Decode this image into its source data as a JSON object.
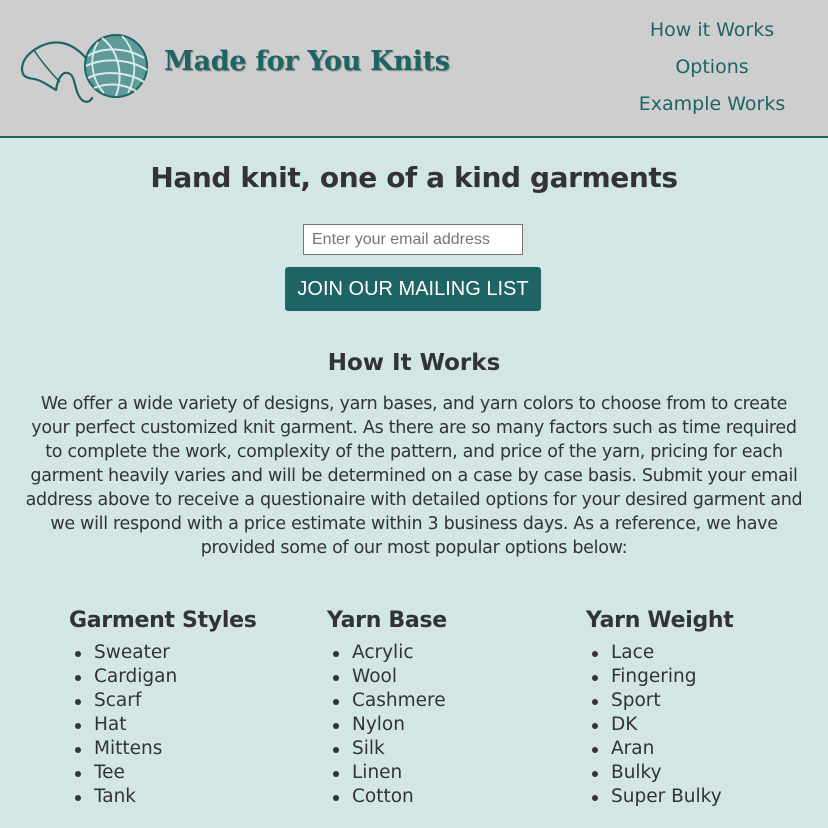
{
  "header": {
    "logo_icon": "yarn-ball-icon",
    "brand": "Made for You Knits",
    "nav": [
      "How it Works",
      "Options",
      "Example Works"
    ]
  },
  "hero": {
    "title": "Hand knit, one of a kind garments",
    "email_placeholder": "Enter your email address",
    "join_label": "JOIN OUR MAILING LIST"
  },
  "how_it_works": {
    "title": "How It Works",
    "body": "We offer a wide variety of designs, yarn bases, and yarn colors to choose from to create your perfect customized knit garment. As there are so many factors such as time required to complete the work, complexity of the pattern, and price of the yarn, pricing for each garment heavily varies and will be determined on a case by case basis. Submit your email address above to receive a questionaire with detailed options for your desired garment and we will respond with a price estimate within 3 business days. As a reference, we have provided some of our most popular options below:"
  },
  "options": [
    {
      "title": "Garment Styles",
      "items": [
        "Sweater",
        "Cardigan",
        "Scarf",
        "Hat",
        "Mittens",
        "Tee",
        "Tank"
      ]
    },
    {
      "title": "Yarn Base",
      "items": [
        "Acrylic",
        "Wool",
        "Cashmere",
        "Nylon",
        "Silk",
        "Linen",
        "Cotton"
      ]
    },
    {
      "title": "Yarn Weight",
      "items": [
        "Lace",
        "Fingering",
        "Sport",
        "DK",
        "Aran",
        "Bulky",
        "Super Bulky"
      ]
    }
  ],
  "colors": {
    "accent": "#1f6465",
    "header_bg": "#cecece",
    "page_bg": "#d2e6e6",
    "text": "#333333"
  }
}
